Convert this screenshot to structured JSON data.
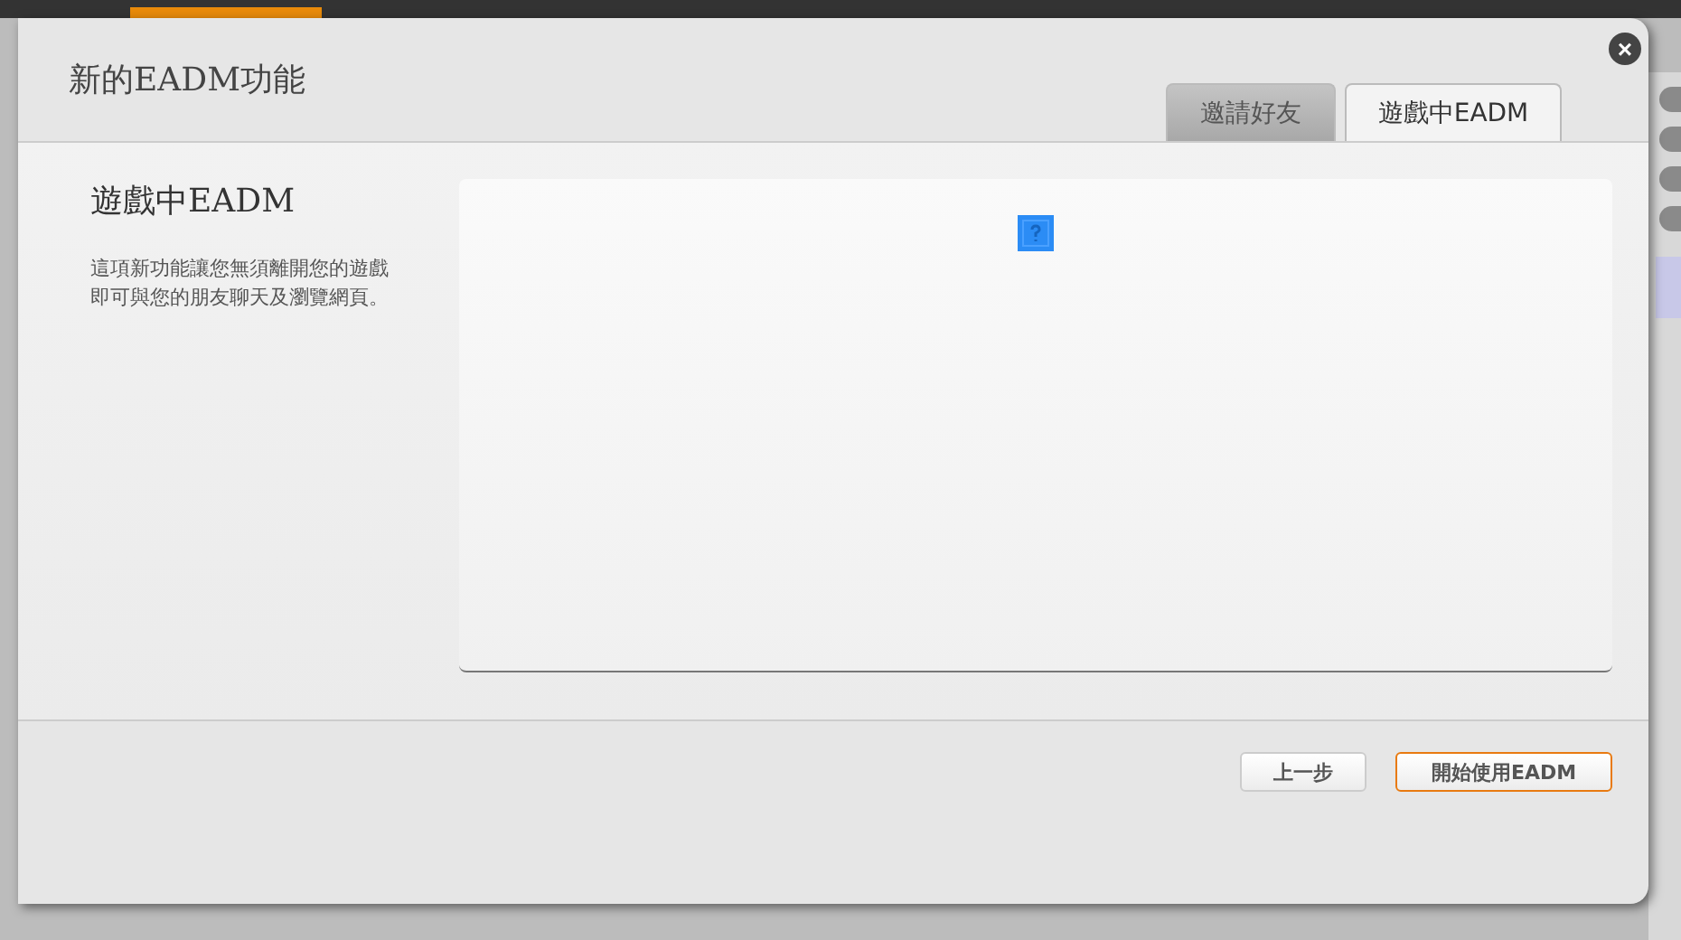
{
  "dialog": {
    "title": "新的EADM功能",
    "close_label": "×",
    "tabs": [
      {
        "label": "邀請好友",
        "selected": false
      },
      {
        "label": "遊戲中EADM",
        "selected": true
      }
    ],
    "heading": "遊戲中EADM",
    "description": "這項新功能讓您無須離開您的遊戲即可與您的朋友聊天及瀏覽網頁。",
    "buttons": [
      {
        "label": "上一步",
        "kind": "secondary"
      },
      {
        "label": "開始使用EADM",
        "kind": "primary"
      }
    ]
  }
}
